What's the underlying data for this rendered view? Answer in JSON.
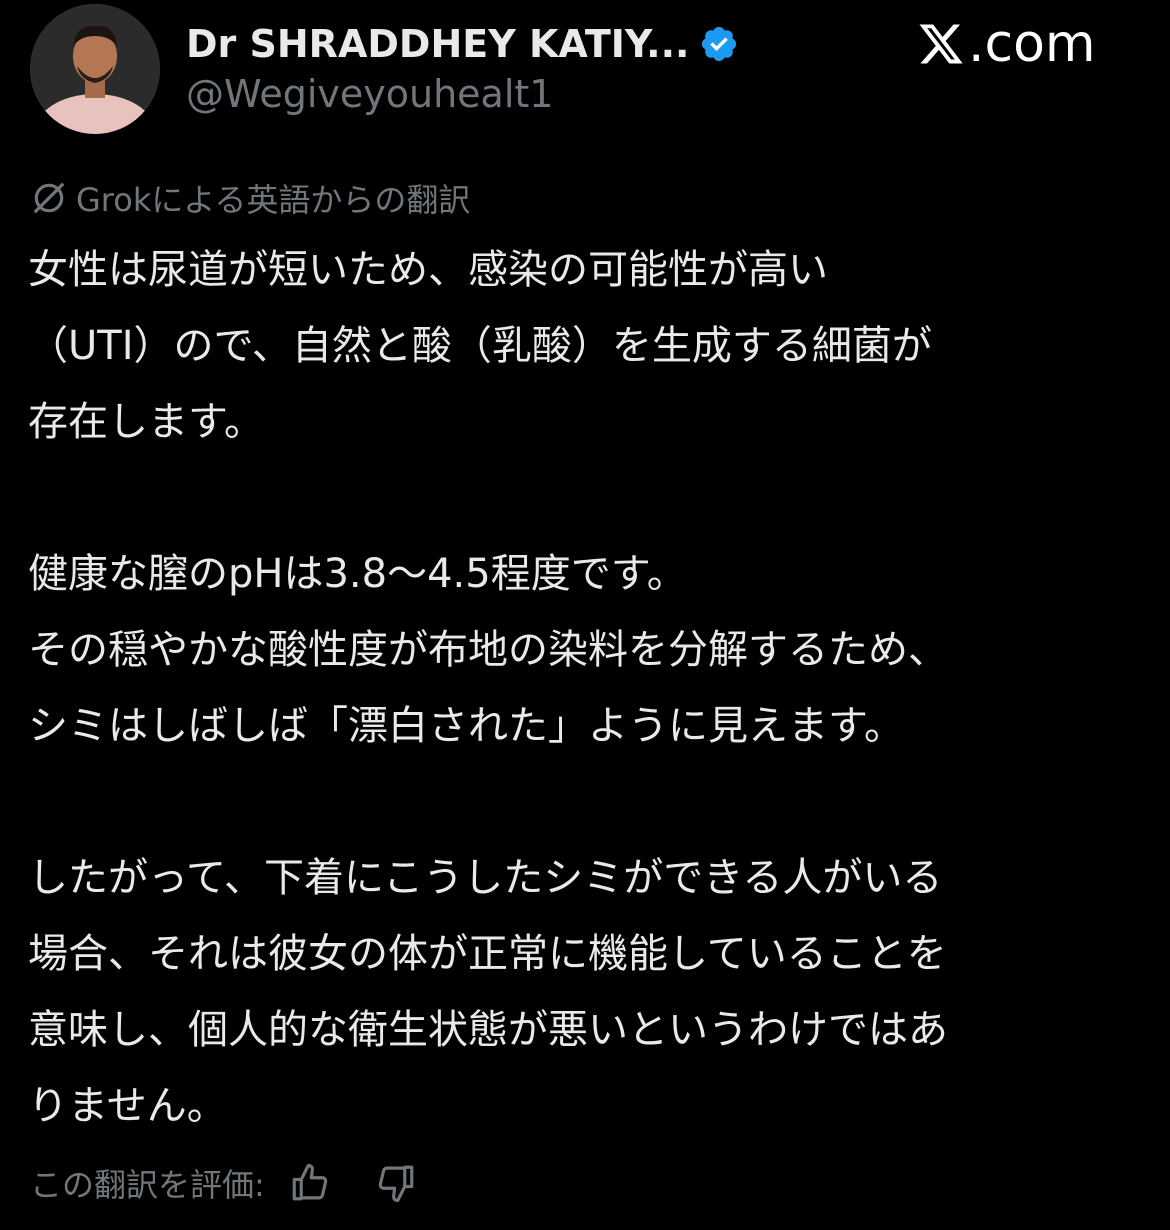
{
  "author": {
    "display_name": "Dr SHRADDHEY KATIY...",
    "handle": "@Wegiveyouhealt1",
    "verified": true,
    "avatar_icon": "profile-photo"
  },
  "brand": {
    "label": ".com",
    "icon": "x-logo-icon"
  },
  "translation": {
    "label": "Grokによる英語からの翻訳",
    "icon": "grok-icon"
  },
  "tweet": {
    "paragraphs": [
      {
        "lines": [
          "女性は尿道が短いため、感染の可能性が高い",
          "（UTI）ので、自然と酸（乳酸）を生成する細菌が",
          "存在します。"
        ]
      },
      {
        "lines": [
          "健康な膣のpHは3.8〜4.5程度です。",
          "その穏やかな酸性度が布地の染料を分解するため、",
          "シミはしばしば「漂白された」ように見えます。"
        ]
      },
      {
        "lines": [
          "したがって、下着にこうしたシミができる人がいる",
          "場合、それは彼女の体が正常に機能していることを",
          "意味し、個人的な衛生状態が悪いというわけではあ",
          "りません。"
        ]
      }
    ]
  },
  "rating": {
    "label": "この翻訳を評価:",
    "thumbs_up_icon": "thumbs-up-icon",
    "thumbs_down_icon": "thumbs-down-icon"
  },
  "colors": {
    "background": "#000000",
    "text_primary": "#e7e9ea",
    "text_secondary": "#71767b",
    "verified_blue": "#1d9bf0"
  }
}
